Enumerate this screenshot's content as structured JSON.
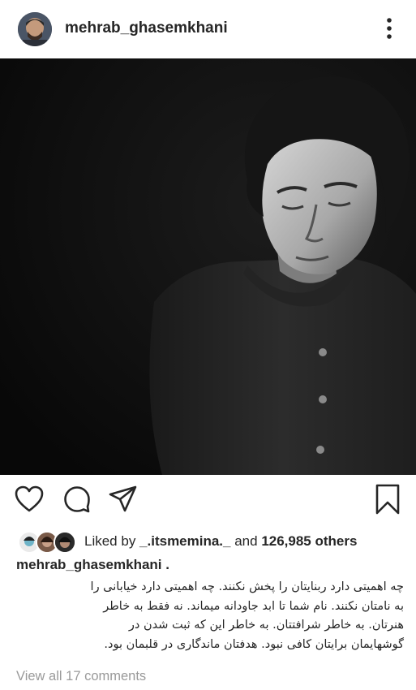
{
  "post": {
    "username": "mehrab_ghasemkhani",
    "more_icon": "vertical-ellipsis-icon",
    "photo_alt": ""
  },
  "actions": {
    "like_icon": "heart-outline-icon",
    "comment_icon": "speech-bubble-icon",
    "share_icon": "paper-plane-icon",
    "save_icon": "bookmark-outline-icon"
  },
  "likes": {
    "prefix": "Liked by ",
    "user": "_.itsmemina._",
    "middle": " and ",
    "count": "126,985 others"
  },
  "caption": {
    "username": "mehrab_ghasemkhani .",
    "lines": [
      "چه اهمیتی دارد ربنایتان را پخش نکنند. چه اهمیتی دارد خیابانی را",
      "به نامتان نکنند. نام شما تا ابد جاودانه میماند. نه فقط به خاطر",
      "هنرتان. به خاطر شرافتتان. به خاطر این که ثبت شدن در",
      "گوشهایمان برایتان کافی نبود. هدفتان ماندگاری در قلبمان بود."
    ]
  },
  "comments_link": "View all 17 comments",
  "colors": {
    "text": "#262626",
    "muted": "#9a9a9a",
    "photo_bg": "#0d0d0d"
  }
}
